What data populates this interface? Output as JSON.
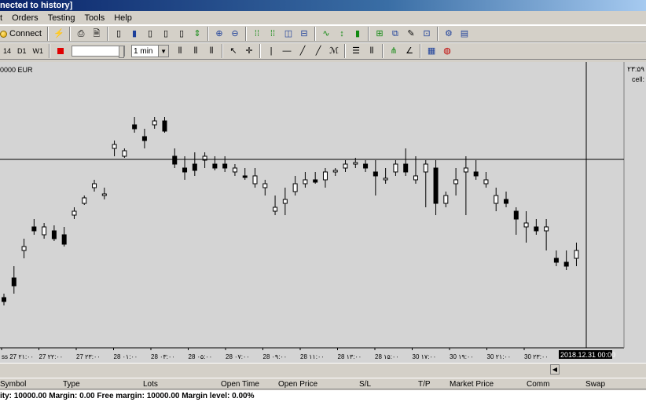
{
  "window": {
    "title": "nected to history]"
  },
  "menu": [
    "t",
    "Orders",
    "Testing",
    "Tools",
    "Help"
  ],
  "toolbar": {
    "connect_label": "Connect",
    "timeframes": [
      "14",
      "D1",
      "W1"
    ],
    "timeframe_select": "1 min"
  },
  "chart": {
    "balance_label": "0000 EUR",
    "right_label_1": "۲۳:۵۹",
    "right_label_2": "cell: ",
    "crosshair_label": "2018.12.31 00:00",
    "colors": {
      "background": "#d4d4d4",
      "bull": "#ffffff",
      "bear": "#000000",
      "crosshair": "#000000"
    }
  },
  "chart_data": {
    "type": "candlestick",
    "x_tick_labels": [
      "ss 27 ۲۱:۰۰",
      "27 ۲۲:۰۰",
      "27 ۲۳:۰۰",
      "28 ۰۱:۰۰",
      "28 ۰۳:۰۰",
      "28 ۰۵:۰۰",
      "28 ۰۷:۰۰",
      "28 ۰۹:۰۰",
      "28 ۱۱:۰۰",
      "28 ۱۳:۰۰",
      "28 ۱۵:۰۰",
      "30 ۱۷:۰۰",
      "30 ۱۹:۰۰",
      "30 ۲۱:۰۰",
      "30 ۲۳:۰۰"
    ],
    "candles": [
      {
        "o": 290,
        "h": 285,
        "l": 300,
        "c": 295
      },
      {
        "o": 265,
        "h": 250,
        "l": 285,
        "c": 275
      },
      {
        "o": 230,
        "h": 215,
        "l": 240,
        "c": 225
      },
      {
        "o": 200,
        "h": 190,
        "l": 210,
        "c": 205
      },
      {
        "o": 210,
        "h": 195,
        "l": 215,
        "c": 200
      },
      {
        "o": 205,
        "h": 198,
        "l": 218,
        "c": 215
      },
      {
        "o": 210,
        "h": 200,
        "l": 225,
        "c": 222
      },
      {
        "o": 185,
        "h": 175,
        "l": 190,
        "c": 180
      },
      {
        "o": 170,
        "h": 160,
        "l": 172,
        "c": 163
      },
      {
        "o": 150,
        "h": 140,
        "l": 155,
        "c": 145
      },
      {
        "o": 160,
        "h": 150,
        "l": 165,
        "c": 158
      },
      {
        "o": 100,
        "h": 90,
        "l": 110,
        "c": 95
      },
      {
        "o": 110,
        "h": 100,
        "l": 112,
        "c": 103
      },
      {
        "o": 70,
        "h": 60,
        "l": 80,
        "c": 75
      },
      {
        "o": 85,
        "h": 75,
        "l": 100,
        "c": 90
      },
      {
        "o": 70,
        "h": 60,
        "l": 75,
        "c": 65
      },
      {
        "o": 65,
        "h": 60,
        "l": 80,
        "c": 78
      },
      {
        "o": 110,
        "h": 100,
        "l": 125,
        "c": 120
      },
      {
        "o": 125,
        "h": 110,
        "l": 140,
        "c": 130
      },
      {
        "o": 120,
        "h": 105,
        "l": 135,
        "c": 128
      },
      {
        "o": 115,
        "h": 105,
        "l": 125,
        "c": 110
      },
      {
        "o": 120,
        "h": 110,
        "l": 128,
        "c": 125
      },
      {
        "o": 120,
        "h": 110,
        "l": 130,
        "c": 125
      },
      {
        "o": 130,
        "h": 120,
        "l": 135,
        "c": 125
      },
      {
        "o": 135,
        "h": 125,
        "l": 140,
        "c": 137
      },
      {
        "o": 145,
        "h": 125,
        "l": 150,
        "c": 135
      },
      {
        "o": 150,
        "h": 140,
        "l": 160,
        "c": 145
      },
      {
        "o": 180,
        "h": 160,
        "l": 185,
        "c": 175
      },
      {
        "o": 170,
        "h": 150,
        "l": 185,
        "c": 165
      },
      {
        "o": 155,
        "h": 135,
        "l": 160,
        "c": 145
      },
      {
        "o": 145,
        "h": 130,
        "l": 150,
        "c": 140
      },
      {
        "o": 140,
        "h": 130,
        "l": 145,
        "c": 143
      },
      {
        "o": 140,
        "h": 125,
        "l": 150,
        "c": 130
      },
      {
        "o": 130,
        "h": 125,
        "l": 135,
        "c": 128
      },
      {
        "o": 125,
        "h": 115,
        "l": 130,
        "c": 120
      },
      {
        "o": 120,
        "h": 112,
        "l": 125,
        "c": 118
      },
      {
        "o": 120,
        "h": 115,
        "l": 130,
        "c": 125
      },
      {
        "o": 130,
        "h": 115,
        "l": 160,
        "c": 135
      },
      {
        "o": 140,
        "h": 125,
        "l": 145,
        "c": 138
      },
      {
        "o": 130,
        "h": 115,
        "l": 135,
        "c": 120
      },
      {
        "o": 120,
        "h": 100,
        "l": 135,
        "c": 130
      },
      {
        "o": 140,
        "h": 110,
        "l": 145,
        "c": 135
      },
      {
        "o": 130,
        "h": 115,
        "l": 175,
        "c": 120
      },
      {
        "o": 125,
        "h": 115,
        "l": 185,
        "c": 170
      },
      {
        "o": 170,
        "h": 155,
        "l": 175,
        "c": 160
      },
      {
        "o": 145,
        "h": 125,
        "l": 160,
        "c": 140
      },
      {
        "o": 130,
        "h": 110,
        "l": 185,
        "c": 125
      },
      {
        "o": 130,
        "h": 115,
        "l": 140,
        "c": 135
      },
      {
        "o": 145,
        "h": 130,
        "l": 150,
        "c": 140
      },
      {
        "o": 170,
        "h": 150,
        "l": 180,
        "c": 160
      },
      {
        "o": 165,
        "h": 155,
        "l": 175,
        "c": 170
      },
      {
        "o": 180,
        "h": 175,
        "l": 210,
        "c": 190
      },
      {
        "o": 200,
        "h": 180,
        "l": 220,
        "c": 195
      },
      {
        "o": 200,
        "h": 190,
        "l": 210,
        "c": 205
      },
      {
        "o": 205,
        "h": 190,
        "l": 230,
        "c": 200
      },
      {
        "o": 240,
        "h": 230,
        "l": 250,
        "c": 245
      },
      {
        "o": 245,
        "h": 230,
        "l": 255,
        "c": 250
      },
      {
        "o": 240,
        "h": 220,
        "l": 250,
        "c": 230
      },
      {
        "o": 250,
        "h": 240,
        "l": 260,
        "c": 255
      }
    ]
  },
  "terminal": {
    "columns": [
      "Symbol",
      "Type",
      "Lots",
      "Open Time",
      "Open Price",
      "S/L",
      "T/P",
      "Market Price",
      "Comm",
      "Swap"
    ]
  },
  "status": {
    "text": "ity: 10000.00  Margin: 0.00  Free margin: 10000.00  Margin level: 0.00%"
  }
}
